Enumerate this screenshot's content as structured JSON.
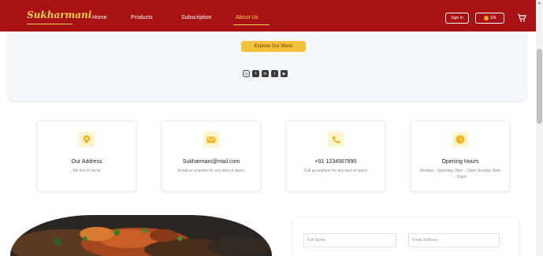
{
  "brand": {
    "name": "Sukharmani"
  },
  "nav": {
    "items": [
      "Home",
      "Products",
      "Subscription",
      "About Us"
    ],
    "active": "About Us",
    "signin_label": "Sign In",
    "lang_label": "EN",
    "cart_icon": "cart-icon"
  },
  "hero": {
    "explore_label": "Explore Our Menu",
    "socials": [
      "instagram-icon",
      "facebook-icon",
      "linkedin-icon",
      "twitter-icon",
      "youtube-icon"
    ]
  },
  "cards": [
    {
      "icon": "map-pin-icon",
      "title": "Our Address",
      "subtitle": "We live to serve"
    },
    {
      "icon": "mail-icon",
      "title": "Sukharmani@mail.com",
      "subtitle": "Email us anytime for any kind of query"
    },
    {
      "icon": "phone-icon",
      "title": "+91 1234567890",
      "subtitle": "Call us anytime for any kind of query"
    },
    {
      "icon": "clock-icon",
      "title": "Opening Hours",
      "subtitle": "Monday - Saturday: 8am - 10pm Sunday: 8am - 10pm"
    }
  ],
  "form": {
    "full_name_placeholder": "Full Name",
    "email_placeholder": "Email Address"
  },
  "colors": {
    "nav_bg": "#a81212",
    "accent": "#f2c23a",
    "brand_text": "#f7d24a",
    "hero_bg": "#f4f7fb",
    "icon_bg": "#fff4cc"
  }
}
